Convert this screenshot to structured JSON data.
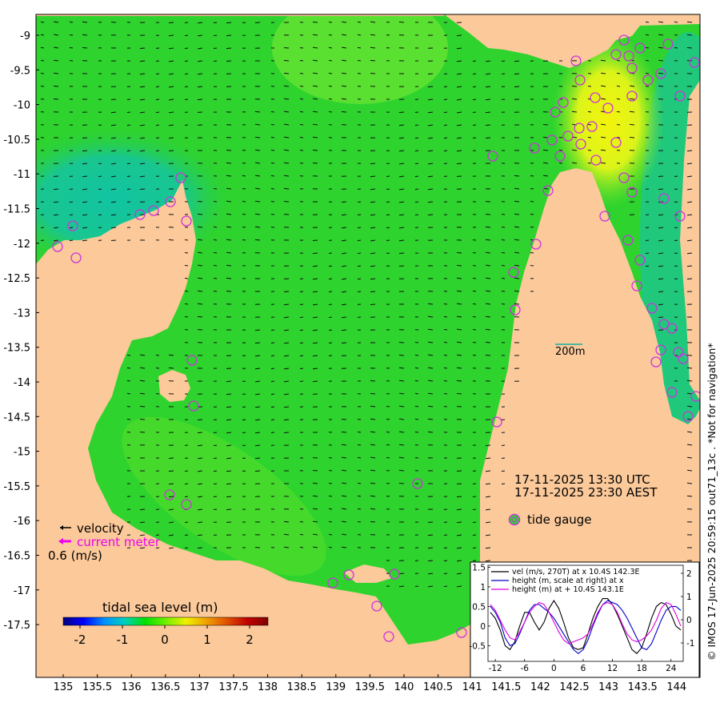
{
  "map": {
    "y_ticks": [
      "-9",
      "-9.5",
      "-10",
      "-10.5",
      "-11",
      "-11.5",
      "-12",
      "-12.5",
      "-13",
      "-13.5",
      "-14",
      "-14.5",
      "-15",
      "-15.5",
      "-16",
      "-16.5",
      "-17",
      "-17.5"
    ],
    "x_ticks": [
      "135",
      "135.5",
      "136",
      "136.5",
      "137",
      "137.5",
      "138",
      "138.5",
      "139",
      "139.5",
      "140",
      "140.5",
      "141",
      "141.5",
      "142",
      "142.5",
      "143",
      "143.5",
      "144"
    ],
    "colors": {
      "land": "#fbc99a",
      "sea_green": "#2ed32e",
      "sea_teal": "#1ac28a",
      "high_yellow": "#e6f515",
      "gauge": "#cc33dd",
      "arrow": "#111111"
    }
  },
  "labels": {
    "scale_bar": "200m",
    "time_utc": "17-11-2025 13:30 UTC",
    "time_aest": "17-11-2025 23:30 AEST",
    "tide_gauge": "tide gauge",
    "velocity": "velocity",
    "current_meter": "current meter",
    "speed": "0.6 (m/s)",
    "colorbar_title": "tidal sea level (m)",
    "side_note": "© IMOS 17-Jun-2025 20:59:15 out71_13c . *Not for navigation*"
  },
  "colorbar": {
    "ticks": [
      "-2",
      "-1",
      "0",
      "1",
      "2"
    ],
    "stops": [
      "#00007f",
      "#0000ff",
      "#0090ff",
      "#00d0c0",
      "#00e000",
      "#70f000",
      "#f0f000",
      "#f0a000",
      "#e05000",
      "#c00000",
      "#800000"
    ]
  },
  "inset": {
    "legend": [
      "vel (m/s, 270T) at x 10.4S 142.3E",
      "height (m, scale at right) at x",
      "height (m) at + 10.4S 143.1E"
    ],
    "y_left_ticks": [
      "1.5",
      "1",
      "0.5",
      "0",
      "-0.5"
    ],
    "y_right_ticks": [
      "2",
      "1",
      "0",
      "-1"
    ],
    "x_ticks": [
      "-12",
      "-6",
      "0",
      "6",
      "12",
      "18",
      "24"
    ],
    "chart_data": {
      "type": "line",
      "x": [
        -13,
        -12,
        -11,
        -10,
        -9,
        -8,
        -7,
        -6,
        -5,
        -4,
        -3,
        -2,
        -1,
        0,
        1,
        2,
        3,
        4,
        5,
        6,
        7,
        8,
        9,
        10,
        11,
        12,
        13,
        14,
        15,
        16,
        17,
        18,
        19,
        20,
        21,
        22,
        23,
        24,
        25,
        26
      ],
      "series": [
        {
          "name": "vel (m/s, 270T) at x 10.4S 142.3E",
          "color": "#000000",
          "values": [
            0.35,
            0.2,
            -0.1,
            -0.5,
            -0.6,
            -0.4,
            0.0,
            0.35,
            0.35,
            0.1,
            -0.1,
            0.1,
            0.45,
            0.65,
            0.45,
            0.1,
            -0.3,
            -0.55,
            -0.6,
            -0.55,
            -0.2,
            0.2,
            0.5,
            0.7,
            0.7,
            0.55,
            0.3,
            0.0,
            -0.3,
            -0.6,
            -0.7,
            -0.55,
            -0.2,
            0.2,
            0.5,
            0.6,
            0.55,
            0.3,
            0.0,
            -0.1
          ]
        },
        {
          "name": "height (m, scale at right) at x",
          "color": "#0000cc",
          "values": [
            0.5,
            0.35,
            0.1,
            -0.3,
            -0.5,
            -0.45,
            -0.2,
            0.1,
            0.4,
            0.55,
            0.55,
            0.45,
            0.35,
            0.2,
            0.0,
            -0.2,
            -0.4,
            -0.6,
            -0.7,
            -0.6,
            -0.35,
            0.0,
            0.3,
            0.55,
            0.65,
            0.6,
            0.55,
            0.4,
            0.2,
            -0.05,
            -0.3,
            -0.55,
            -0.6,
            -0.45,
            -0.15,
            0.15,
            0.4,
            0.5,
            0.5,
            0.4
          ]
        },
        {
          "name": "height (m) at + 10.4S 143.1E",
          "color": "#dd00dd",
          "values": [
            0.55,
            0.4,
            0.15,
            -0.1,
            -0.3,
            -0.35,
            -0.15,
            0.1,
            0.35,
            0.5,
            0.6,
            0.55,
            0.35,
            0.1,
            -0.15,
            -0.35,
            -0.45,
            -0.4,
            -0.35,
            -0.3,
            -0.2,
            0.05,
            0.35,
            0.55,
            0.6,
            0.55,
            0.35,
            0.05,
            -0.2,
            -0.35,
            -0.4,
            -0.35,
            -0.25,
            -0.1,
            0.15,
            0.45,
            0.6,
            0.55,
            0.3,
            0.0
          ]
        }
      ],
      "xlim": [
        -13.5,
        26.5
      ],
      "ylim": [
        -0.9,
        1.55
      ]
    }
  }
}
